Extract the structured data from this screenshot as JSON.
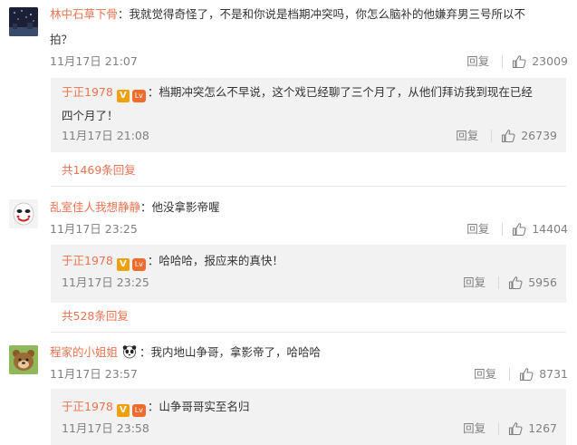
{
  "colors": {
    "accent": "#eb7350",
    "reply_bg": "#f2f2f2",
    "text": "#333333",
    "meta": "#808080",
    "vip_badge": "#f0a00a",
    "level_badge": "#f06c2d"
  },
  "labels": {
    "reply": "回复",
    "v_badge": "V",
    "level_badge": "Lv"
  },
  "comments": [
    {
      "user": "林中石草下骨",
      "text_line1": "：我就觉得奇怪了，不是和你说是档期冲突吗，你怎么脑补的他嫌弃男三号所以不",
      "text_line2": "拍？",
      "time": "11月17日 21:07",
      "likes": "23009",
      "reply": {
        "user": "于正1978",
        "text_line1": "：档期冲突怎么不早说，这个戏已经聊了三个月了，从他们拜访我到现在已经",
        "text_line2": "四个月了！",
        "time": "11月17日 21:08",
        "likes": "26739",
        "more": "共1469条回复"
      }
    },
    {
      "user": "乱室佳人我想静静",
      "text": "：他没拿影帝喔",
      "time": "11月17日 23:25",
      "likes": "14404",
      "reply": {
        "user": "于正1978",
        "text": "：哈哈哈，报应来的真快！",
        "time": "11月17日 23:25",
        "likes": "5956",
        "more": "共528条回复"
      }
    },
    {
      "user": "程家的小姐姐",
      "text": "：我内地山争哥，拿影帝了，哈哈哈",
      "time": "11月17日 23:57",
      "likes": "8731",
      "reply": {
        "user": "于正1978",
        "text": "：山争哥哥实至名归",
        "time": "11月17日 23:58",
        "likes": "1267"
      }
    }
  ]
}
